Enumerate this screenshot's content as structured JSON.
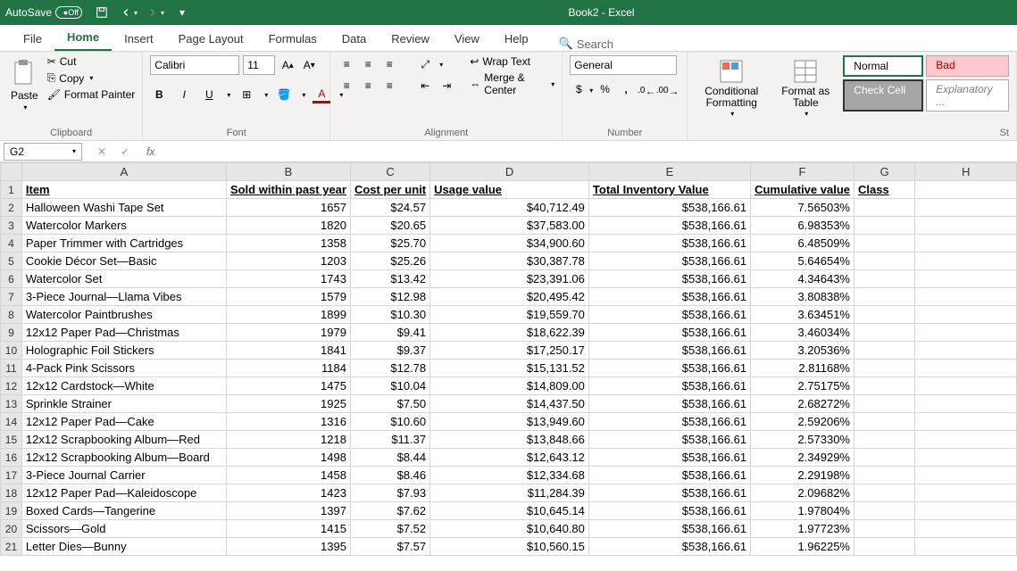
{
  "title_bar": {
    "autosave_label": "AutoSave",
    "autosave_state": "Off",
    "doc_title": "Book2 - Excel"
  },
  "menu": {
    "tabs": [
      "File",
      "Home",
      "Insert",
      "Page Layout",
      "Formulas",
      "Data",
      "Review",
      "View",
      "Help"
    ],
    "active": "Home",
    "search_label": "Search"
  },
  "ribbon": {
    "clipboard": {
      "paste": "Paste",
      "cut": "Cut",
      "copy": "Copy",
      "format_painter": "Format Painter",
      "label": "Clipboard"
    },
    "font": {
      "name": "Calibri",
      "size": "11",
      "label": "Font"
    },
    "alignment": {
      "wrap": "Wrap Text",
      "merge": "Merge & Center",
      "label": "Alignment"
    },
    "number": {
      "format": "General",
      "label": "Number"
    },
    "styles": {
      "cond": "Conditional Formatting",
      "table": "Format as Table",
      "normal": "Normal",
      "bad": "Bad",
      "check": "Check Cell",
      "explanatory": "Explanatory ...",
      "label": "St"
    }
  },
  "formula_bar": {
    "name_box": "G2",
    "formula": ""
  },
  "columns": [
    "A",
    "B",
    "C",
    "D",
    "E",
    "F",
    "G",
    "H"
  ],
  "headers": {
    "A": "Item",
    "B": "Sold within past year",
    "C": "Cost per unit",
    "D": "Usage value",
    "E": "Total Inventory Value",
    "F": "Cumulative value",
    "G": "Class"
  },
  "chart_data": {
    "type": "table",
    "columns": [
      "Item",
      "Sold within past year",
      "Cost per unit",
      "Usage value",
      "Total Inventory Value",
      "Cumulative value",
      "Class"
    ],
    "rows": [
      {
        "item": "Halloween Washi Tape Set",
        "sold": 1657,
        "cost": "$24.57",
        "usage": "$40,712.49",
        "total": "$538,166.61",
        "cum": "7.56503%",
        "class": ""
      },
      {
        "item": "Watercolor Markers",
        "sold": 1820,
        "cost": "$20.65",
        "usage": "$37,583.00",
        "total": "$538,166.61",
        "cum": "6.98353%",
        "class": ""
      },
      {
        "item": "Paper Trimmer with Cartridges",
        "sold": 1358,
        "cost": "$25.70",
        "usage": "$34,900.60",
        "total": "$538,166.61",
        "cum": "6.48509%",
        "class": ""
      },
      {
        "item": "Cookie Décor Set—Basic",
        "sold": 1203,
        "cost": "$25.26",
        "usage": "$30,387.78",
        "total": "$538,166.61",
        "cum": "5.64654%",
        "class": ""
      },
      {
        "item": "Watercolor Set",
        "sold": 1743,
        "cost": "$13.42",
        "usage": "$23,391.06",
        "total": "$538,166.61",
        "cum": "4.34643%",
        "class": ""
      },
      {
        "item": "3-Piece Journal—Llama Vibes",
        "sold": 1579,
        "cost": "$12.98",
        "usage": "$20,495.42",
        "total": "$538,166.61",
        "cum": "3.80838%",
        "class": ""
      },
      {
        "item": "Watercolor Paintbrushes",
        "sold": 1899,
        "cost": "$10.30",
        "usage": "$19,559.70",
        "total": "$538,166.61",
        "cum": "3.63451%",
        "class": ""
      },
      {
        "item": "12x12 Paper Pad—Christmas",
        "sold": 1979,
        "cost": "$9.41",
        "usage": "$18,622.39",
        "total": "$538,166.61",
        "cum": "3.46034%",
        "class": ""
      },
      {
        "item": "Holographic Foil Stickers",
        "sold": 1841,
        "cost": "$9.37",
        "usage": "$17,250.17",
        "total": "$538,166.61",
        "cum": "3.20536%",
        "class": ""
      },
      {
        "item": "4-Pack Pink Scissors",
        "sold": 1184,
        "cost": "$12.78",
        "usage": "$15,131.52",
        "total": "$538,166.61",
        "cum": "2.81168%",
        "class": ""
      },
      {
        "item": "12x12 Cardstock—White",
        "sold": 1475,
        "cost": "$10.04",
        "usage": "$14,809.00",
        "total": "$538,166.61",
        "cum": "2.75175%",
        "class": ""
      },
      {
        "item": "Sprinkle Strainer",
        "sold": 1925,
        "cost": "$7.50",
        "usage": "$14,437.50",
        "total": "$538,166.61",
        "cum": "2.68272%",
        "class": ""
      },
      {
        "item": "12x12 Paper Pad—Cake",
        "sold": 1316,
        "cost": "$10.60",
        "usage": "$13,949.60",
        "total": "$538,166.61",
        "cum": "2.59206%",
        "class": ""
      },
      {
        "item": "12x12 Scrapbooking Album—Red",
        "sold": 1218,
        "cost": "$11.37",
        "usage": "$13,848.66",
        "total": "$538,166.61",
        "cum": "2.57330%",
        "class": ""
      },
      {
        "item": "12x12 Scrapbooking Album—Board",
        "sold": 1498,
        "cost": "$8.44",
        "usage": "$12,643.12",
        "total": "$538,166.61",
        "cum": "2.34929%",
        "class": ""
      },
      {
        "item": "3-Piece Journal Carrier",
        "sold": 1458,
        "cost": "$8.46",
        "usage": "$12,334.68",
        "total": "$538,166.61",
        "cum": "2.29198%",
        "class": ""
      },
      {
        "item": "12x12 Paper Pad—Kaleidoscope",
        "sold": 1423,
        "cost": "$7.93",
        "usage": "$11,284.39",
        "total": "$538,166.61",
        "cum": "2.09682%",
        "class": ""
      },
      {
        "item": "Boxed Cards—Tangerine",
        "sold": 1397,
        "cost": "$7.62",
        "usage": "$10,645.14",
        "total": "$538,166.61",
        "cum": "1.97804%",
        "class": ""
      },
      {
        "item": "Scissors—Gold",
        "sold": 1415,
        "cost": "$7.52",
        "usage": "$10,640.80",
        "total": "$538,166.61",
        "cum": "1.97723%",
        "class": ""
      },
      {
        "item": "Letter Dies—Bunny",
        "sold": 1395,
        "cost": "$7.57",
        "usage": "$10,560.15",
        "total": "$538,166.61",
        "cum": "1.96225%",
        "class": ""
      }
    ]
  }
}
